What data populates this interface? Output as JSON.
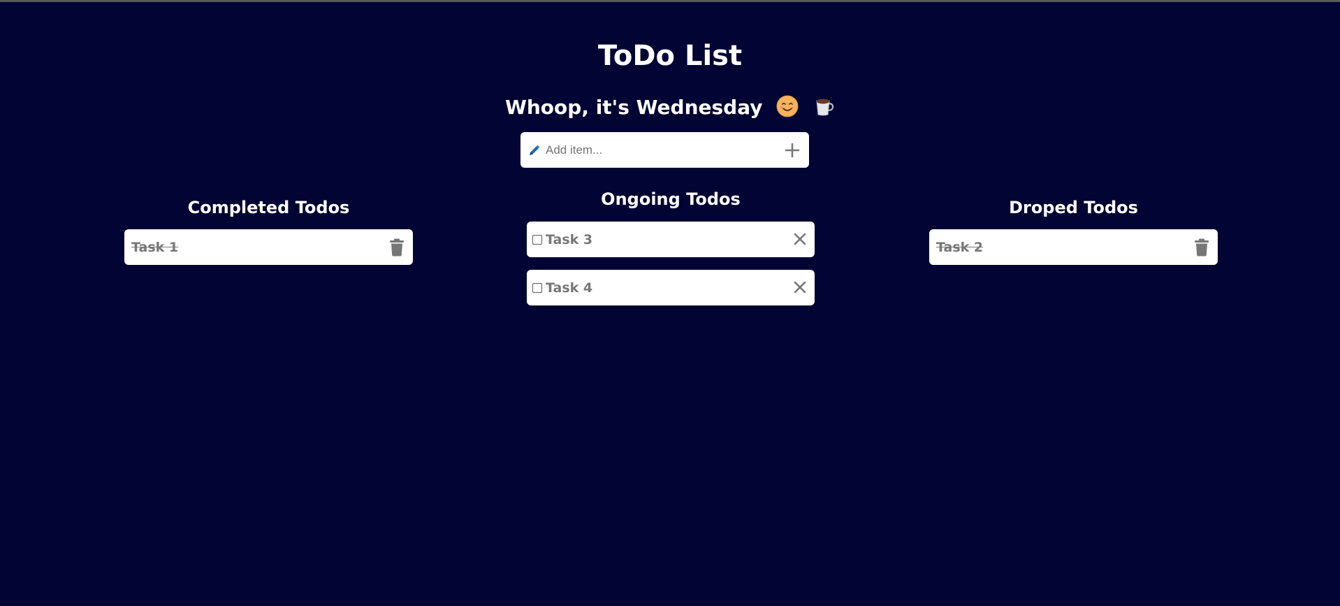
{
  "header": {
    "title": "ToDo List",
    "greeting": "Whoop, it's Wednesday"
  },
  "add_item": {
    "placeholder": "Add item...",
    "value": ""
  },
  "columns": {
    "completed": {
      "heading": "Completed Todos",
      "items": [
        {
          "label": "Task 1"
        }
      ]
    },
    "ongoing": {
      "heading": "Ongoing Todos",
      "items": [
        {
          "label": "Task 3"
        },
        {
          "label": "Task 4"
        }
      ]
    },
    "dropped": {
      "heading": "Droped Todos",
      "items": [
        {
          "label": "Task 2"
        }
      ]
    }
  },
  "icons": {
    "greeting_1": "smiling-face-icon",
    "greeting_2": "coffee-cup-icon",
    "input": "pencil-icon",
    "add": "plus-icon",
    "completed_action": "trash-icon",
    "ongoing_action": "close-icon",
    "dropped_action": "trash-icon"
  },
  "colors": {
    "background": "#020433",
    "card": "#ffffff",
    "muted_text": "#777777",
    "pencil": "#1e6bb8"
  }
}
